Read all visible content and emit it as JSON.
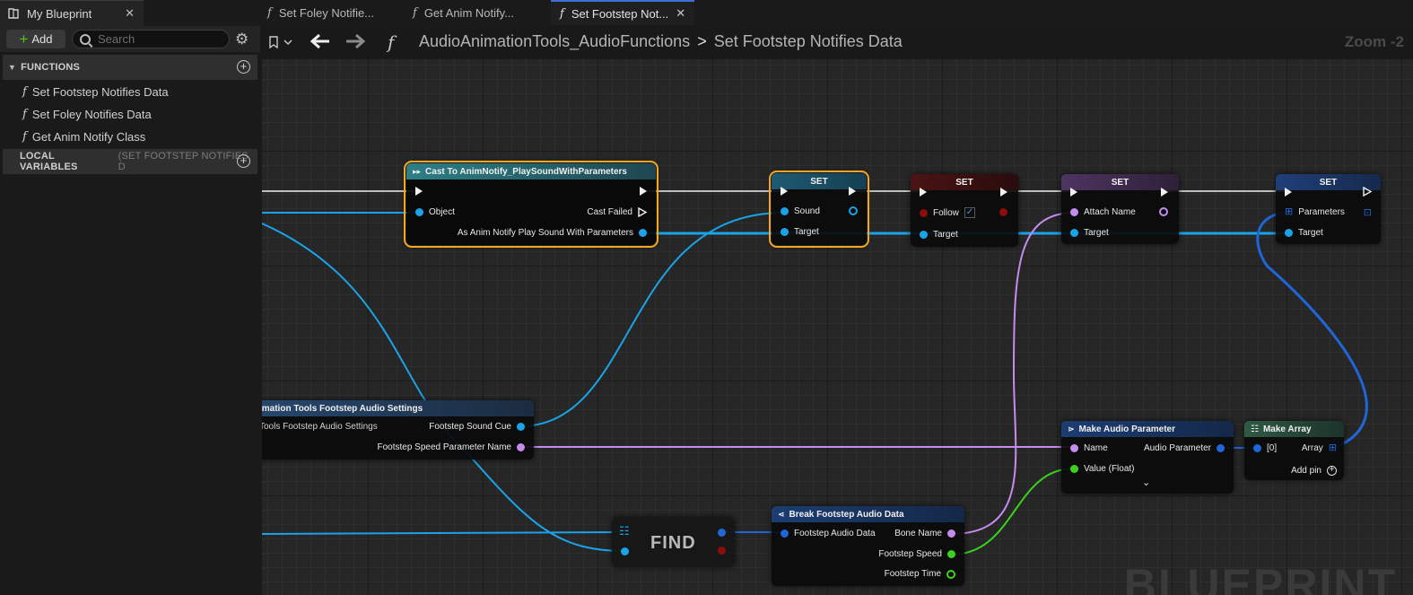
{
  "left_panel": {
    "tab_title": "My Blueprint",
    "add_label": "Add",
    "search_placeholder": "Search",
    "functions_header": "FUNCTIONS",
    "functions": [
      "Set Footstep Notifies Data",
      "Set Foley Notifies Data",
      "Get Anim Notify Class"
    ],
    "local_variables_header": "LOCAL VARIABLES",
    "local_variables_scope": "(SET FOOTSTEP NOTIFIES D"
  },
  "tabs": [
    "Set Foley Notifie...",
    "Get Anim Notify...",
    "Set Footstep Not..."
  ],
  "breadcrumb": {
    "library": "AudioAnimationTools_AudioFunctions",
    "separator": ">",
    "function": "Set Footstep Notifies Data"
  },
  "zoom": "Zoom -2",
  "watermark": "BLUEPRINT",
  "nodes": {
    "cast": {
      "title": "Cast To AnimNotify_PlaySoundWithParameters",
      "object": "Object",
      "cast_failed": "Cast Failed",
      "as_output": "As Anim Notify Play Sound With Parameters"
    },
    "set1": {
      "title": "SET",
      "sound": "Sound",
      "target": "Target"
    },
    "set2": {
      "title": "SET",
      "follow": "Follow",
      "target": "Target"
    },
    "set3": {
      "title": "SET",
      "attach_name": "Attach Name",
      "target": "Target"
    },
    "set4": {
      "title": "SET",
      "parameters": "Parameters",
      "target": "Target"
    },
    "settings": {
      "title": "imation Tools Footstep Audio Settings",
      "subtitle": "Tools Footstep Audio Settings",
      "sound_cue": "Footstep Sound Cue",
      "speed_param": "Footstep Speed Parameter Name"
    },
    "find": {
      "title": "FIND"
    },
    "break": {
      "title": "Break Footstep Audio Data",
      "input": "Footstep Audio Data",
      "bone_name": "Bone Name",
      "speed": "Footstep Speed",
      "time": "Footstep Time"
    },
    "make_param": {
      "title": "Make Audio Parameter",
      "name": "Name",
      "output": "Audio Parameter",
      "value": "Value (Float)"
    },
    "make_array": {
      "title": "Make Array",
      "index0": "[0]",
      "array": "Array",
      "add_pin": "Add pin"
    }
  },
  "colors": {
    "exec": "#f2f2f2",
    "object": "#1aa3e8",
    "name": "#c58cf0",
    "float": "#3bd21c",
    "struct": "#1f66d8",
    "bool": "#8c0d0d",
    "selection": "#f5a623",
    "accent": "#3f6fd8"
  }
}
